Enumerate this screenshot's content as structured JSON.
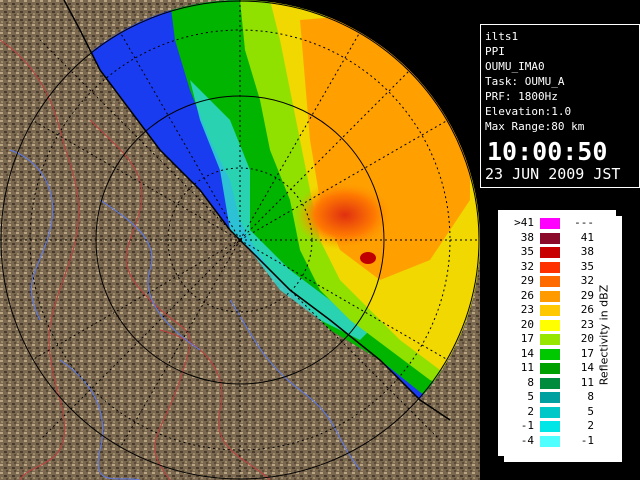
{
  "info": {
    "lines": [
      "ilts1",
      "PPI",
      "OUMU_IMA0",
      "Task: OUMU_A",
      "PRF: 1800Hz",
      "Elevation:1.0",
      "Max Range:80 km"
    ],
    "time": "10:00:50",
    "date": "23 JUN 2009 JST"
  },
  "legend": {
    "title": "Reflectivity in dBZ",
    "rows": [
      {
        "min": ">41",
        "max": "---",
        "color": "#ff00ff"
      },
      {
        "min": "38",
        "max": "41",
        "color": "#8b0a2a"
      },
      {
        "min": "35",
        "max": "38",
        "color": "#c80000"
      },
      {
        "min": "32",
        "max": "35",
        "color": "#ff3000"
      },
      {
        "min": "29",
        "max": "32",
        "color": "#ff6a00"
      },
      {
        "min": "26",
        "max": "29",
        "color": "#ff9a00"
      },
      {
        "min": "23",
        "max": "26",
        "color": "#ffc800"
      },
      {
        "min": "20",
        "max": "23",
        "color": "#ffff00"
      },
      {
        "min": "17",
        "max": "20",
        "color": "#96e600"
      },
      {
        "min": "14",
        "max": "17",
        "color": "#00c800"
      },
      {
        "min": "11",
        "max": "14",
        "color": "#00a000"
      },
      {
        "min": "8",
        "max": "11",
        "color": "#008c3c"
      },
      {
        "min": "5",
        "max": "8",
        "color": "#00a0a0"
      },
      {
        "min": "2",
        "max": "5",
        "color": "#00c8c8"
      },
      {
        "min": "-1",
        "max": "2",
        "color": "#00e6e6"
      },
      {
        "min": "-4",
        "max": "-1",
        "color": "#50ffff"
      }
    ]
  },
  "colors": {
    "sea": "#1a3cf0",
    "land": "#7a6850",
    "range_ring": "#000000",
    "river": "#5a7af0",
    "boundary": "#c04040"
  }
}
